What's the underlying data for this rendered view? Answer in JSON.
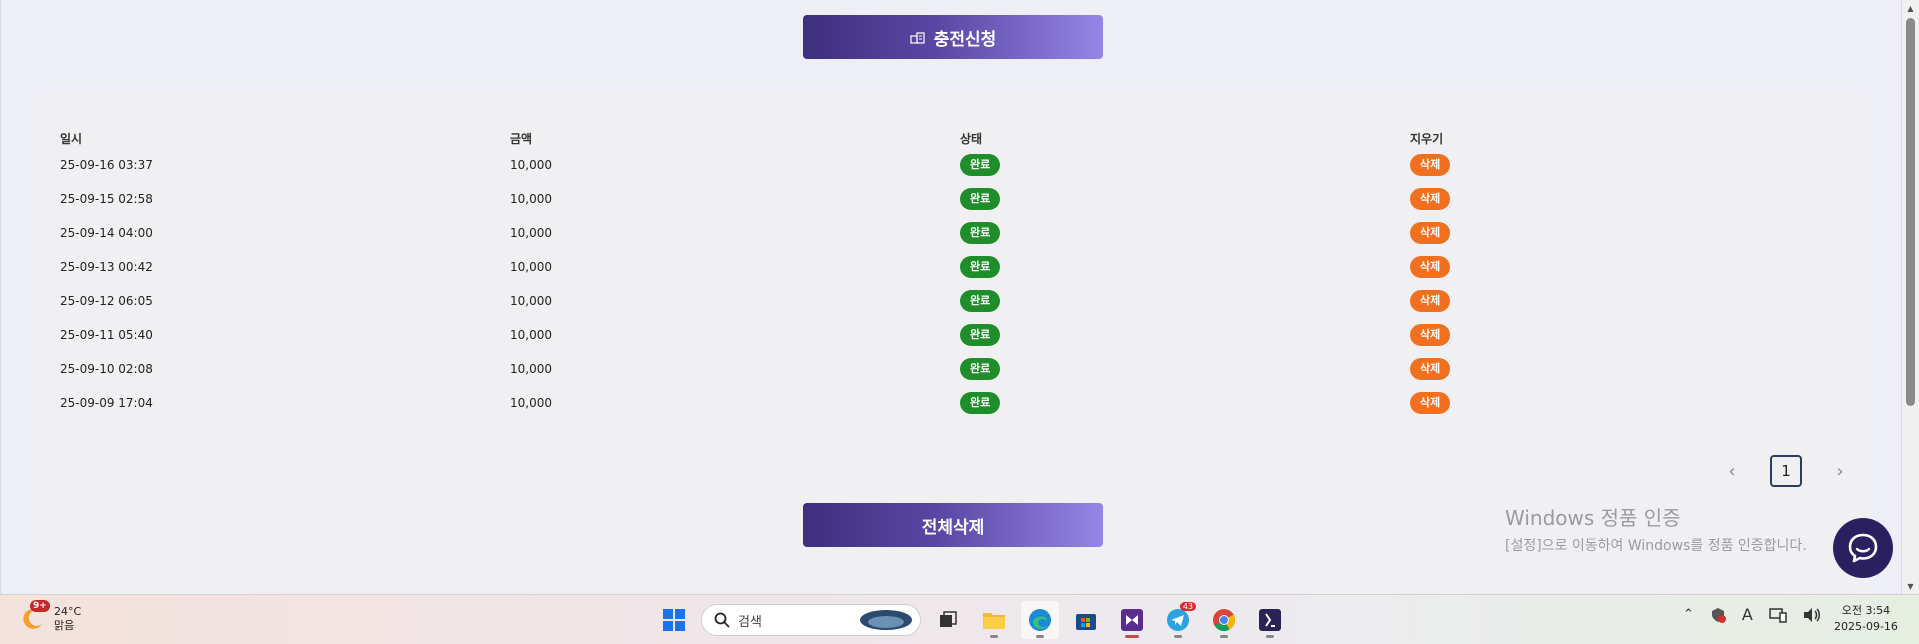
{
  "buttons": {
    "charge_request": "충전신청",
    "delete_all": "전체삭제"
  },
  "table": {
    "headers": {
      "date": "일시",
      "amount": "금액",
      "status": "상태",
      "delete": "지우기"
    },
    "rows": [
      {
        "date": "25-09-16 03:37",
        "amount": "10,000",
        "status": "완료",
        "delete": "삭제"
      },
      {
        "date": "25-09-15 02:58",
        "amount": "10,000",
        "status": "완료",
        "delete": "삭제"
      },
      {
        "date": "25-09-14 04:00",
        "amount": "10,000",
        "status": "완료",
        "delete": "삭제"
      },
      {
        "date": "25-09-13 00:42",
        "amount": "10,000",
        "status": "완료",
        "delete": "삭제"
      },
      {
        "date": "25-09-12 06:05",
        "amount": "10,000",
        "status": "완료",
        "delete": "삭제"
      },
      {
        "date": "25-09-11 05:40",
        "amount": "10,000",
        "status": "완료",
        "delete": "삭제"
      },
      {
        "date": "25-09-10 02:08",
        "amount": "10,000",
        "status": "완료",
        "delete": "삭제"
      },
      {
        "date": "25-09-09 17:04",
        "amount": "10,000",
        "status": "완료",
        "delete": "삭제"
      }
    ]
  },
  "pagination": {
    "prev": "‹",
    "current": "1",
    "next": "›"
  },
  "watermark": {
    "title": "Windows 정품 인증",
    "subtitle": "[설정]으로 이동하여 Windows를 정품 인증합니다."
  },
  "taskbar": {
    "weather": {
      "badge": "9+",
      "temperature": "24°C",
      "condition": "맑음"
    },
    "search_placeholder": "검색",
    "telegram_badge": "43",
    "tray_font_label": "A",
    "clock": {
      "time": "오전 3:54",
      "date": "2025-09-16"
    }
  },
  "colors": {
    "button_gradient_start": "#3f2f7e",
    "button_gradient_end": "#9585e6",
    "status_complete": "#1f8e2a",
    "delete_badge": "#f07020",
    "chat_button": "#2a2060"
  }
}
